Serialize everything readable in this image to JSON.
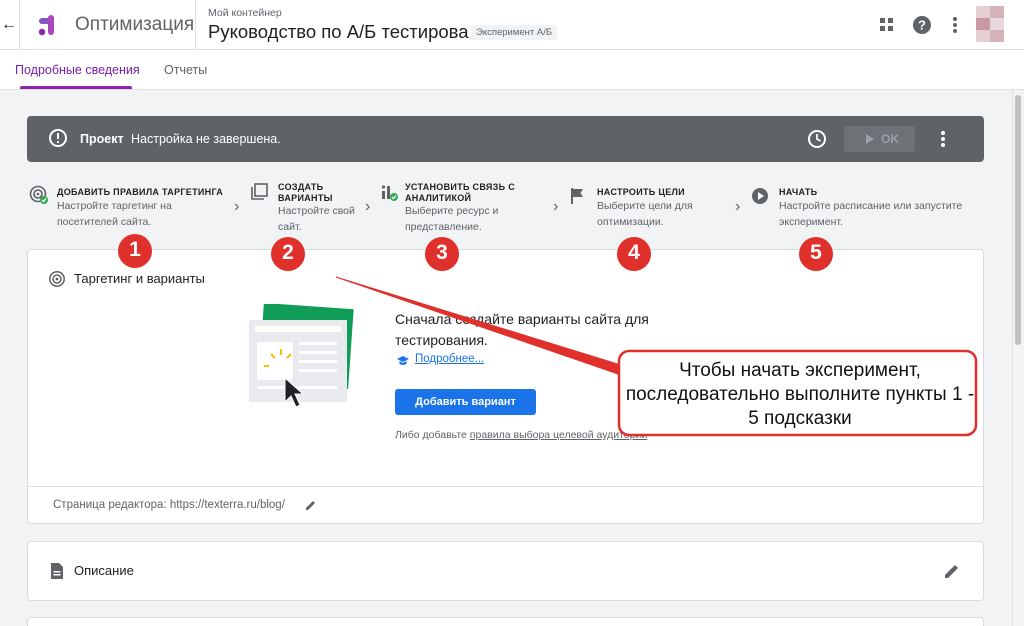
{
  "header": {
    "back_icon": "arrow-left-icon",
    "app_title": "Оптимизация",
    "container_label": "Мой контейнер",
    "experiment_name": "Руководство по А/Б тестирова",
    "experiment_badge": "Эксперимент А/Б",
    "icons": [
      "apps-icon",
      "help-icon",
      "more-vert-icon"
    ],
    "brand_color": "#8e24aa"
  },
  "tabs": [
    {
      "label": "Подробные сведения",
      "active": true
    },
    {
      "label": "Отчеты",
      "active": false
    }
  ],
  "status_bar": {
    "project_label": "Проект",
    "status_text": "Настройка не завершена.",
    "ok_label": "OK",
    "background": "#5f6368"
  },
  "steps": [
    {
      "title": "ДОБАВИТЬ ПРАВИЛА ТАРГЕТИНГА",
      "desc_lines": [
        "Настройте таргетинг на",
        "посетителей сайта."
      ],
      "icon": "target-check-icon"
    },
    {
      "title_lines": [
        "СОЗДАТЬ",
        "ВАРИАНТЫ"
      ],
      "desc_lines": [
        "Настройте свой",
        "сайт."
      ],
      "icon": "copy-variants-icon"
    },
    {
      "title_lines": [
        "УСТАНОВИТЬ СВЯЗЬ С",
        "АНАЛИТИКОЙ"
      ],
      "desc_lines": [
        "Выберите ресурс и",
        "представление."
      ],
      "icon": "analytics-check-icon"
    },
    {
      "title": "НАСТРОИТЬ ЦЕЛИ",
      "desc_lines": [
        "Выберите цели для",
        "оптимизации."
      ],
      "icon": "flag-icon"
    },
    {
      "title": "НАЧАТЬ",
      "desc_lines": [
        "Настройте расписание или запустите",
        "эксперимент."
      ],
      "icon": "play-circle-icon"
    }
  ],
  "targeting_card": {
    "title": "Таргетинг и варианты",
    "intro": "Сначала создайте варианты сайта для тестирования.",
    "learn_more": "Подробнее...",
    "add_button": "Добавить вариант",
    "alt_prefix": "Либо добавьте",
    "alt_link": "правила выбора целевой аудитории",
    "editor_page": "Страница редактора: https://texterra.ru/blog/"
  },
  "description_card": {
    "title": "Описание"
  },
  "annotation": {
    "numbers": [
      "1",
      "2",
      "3",
      "4",
      "5"
    ],
    "callout": "Чтобы начать эксперимент, последовательно выполните пункты 1 - 5 подсказки",
    "color": "#e0302c"
  }
}
